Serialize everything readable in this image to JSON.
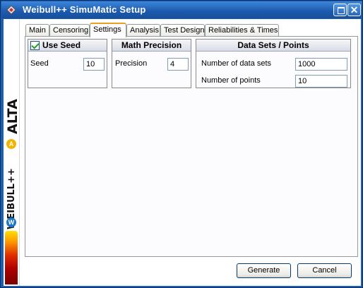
{
  "window": {
    "title": "Weibull++ SimuMatic Setup",
    "icons": {
      "app": "app-logo-icon",
      "minimize": "minimize-icon",
      "close": "close-icon"
    },
    "close_glyph": "✕"
  },
  "branding": {
    "alta_label": "ALTA",
    "weibull_label": "WEIBULL++",
    "alta_badge": "A",
    "weibull_badge": "W"
  },
  "tabs": [
    {
      "label": "Main"
    },
    {
      "label": "Censoring"
    },
    {
      "label": "Settings",
      "active": true
    },
    {
      "label": "Analysis"
    },
    {
      "label": "Test Design"
    },
    {
      "label": "Reliabilities & Times"
    }
  ],
  "settings": {
    "use_seed": {
      "header": "Use Seed",
      "checked": true,
      "seed_label": "Seed",
      "seed_value": "10"
    },
    "math_precision": {
      "header": "Math Precision",
      "precision_label": "Precision",
      "precision_value": "4"
    },
    "data_sets_points": {
      "header": "Data Sets / Points",
      "data_sets_label": "Number of data sets",
      "data_sets_value": "1000",
      "points_label": "Number of points",
      "points_value": "10"
    }
  },
  "buttons": {
    "generate": "Generate",
    "cancel": "Cancel"
  },
  "colors": {
    "titlebar": "#1c59ad",
    "active_tab_accent": "#e8a020",
    "checkmark": "#21a121"
  }
}
